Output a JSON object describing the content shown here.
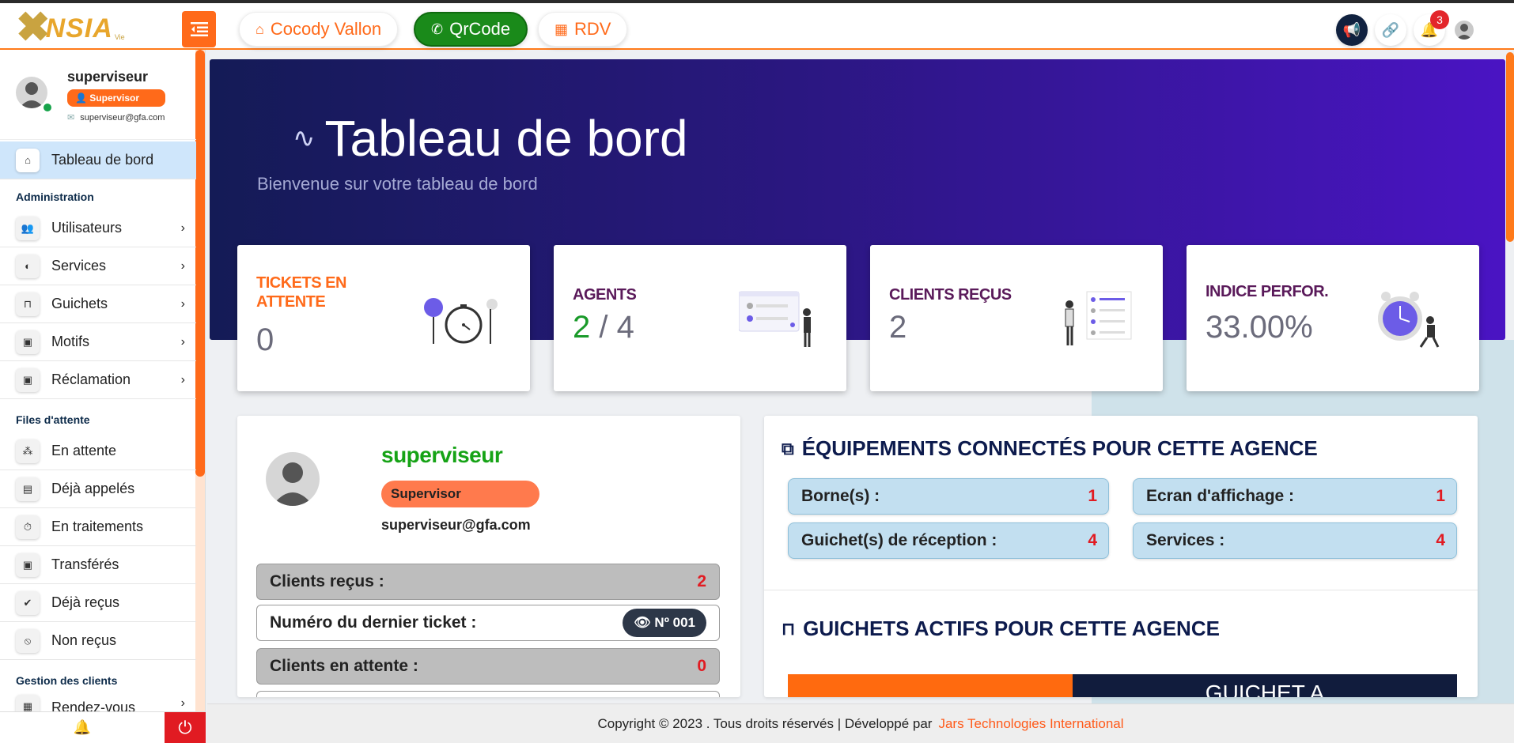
{
  "topbar": {
    "logo": {
      "mark": "✖",
      "text": "NSIA",
      "sub": "Vie"
    },
    "agency_label": "Cocody Vallon",
    "qrcode_label": "QrCode",
    "rdv_label": "RDV",
    "notification_count": "3"
  },
  "profile": {
    "name": "superviseur",
    "role": "Supervisor",
    "email": "superviseur@gfa.com"
  },
  "sidebar": {
    "dashboard": "Tableau de bord",
    "section_admin": "Administration",
    "admin_items": [
      "Utilisateurs",
      "Services",
      "Guichets",
      "Motifs",
      "Réclamation"
    ],
    "section_queues": "Files d'attente",
    "queue_items": [
      "En attente",
      "Déjà appelés",
      "En traitements",
      "Transférés",
      "Déjà reçus",
      "Non reçus"
    ],
    "section_clients": "Gestion des clients",
    "client_items": [
      "Rendez-vous"
    ]
  },
  "hero": {
    "title": "Tableau de bord",
    "subtitle": "Bienvenue sur votre tableau de bord"
  },
  "stats": [
    {
      "label_line1": "TICKETS EN",
      "label_line2": "ATTENTE",
      "value": "0",
      "color": "#ff6a1a"
    },
    {
      "label": "AGENTS",
      "value_active": "2",
      "value_sep": " / ",
      "value_total": "4",
      "color": "#5a1a5a"
    },
    {
      "label": "CLIENTS REÇUS",
      "value": "2",
      "color": "#5a1a5a"
    },
    {
      "label": "INDICE PERFOR.",
      "value": "33.00%",
      "color": "#5a1a5a"
    }
  ],
  "supervisor_card": {
    "name": "superviseur",
    "role": "Supervisor",
    "email": "superviseur@gfa.com",
    "clients_recus_label": "Clients reçus :",
    "clients_recus_value": "2",
    "last_ticket_label": "Numéro du dernier ticket :",
    "last_ticket_value": "Nº 001",
    "clients_attente_label": "Clients en attente :",
    "clients_attente_value": "0"
  },
  "equipment": {
    "title": "ÉQUIPEMENTS CONNECTÉS POUR CETTE AGENCE",
    "items": [
      {
        "label": "Borne(s) :",
        "value": "1"
      },
      {
        "label": "Ecran d'affichage :",
        "value": "1"
      },
      {
        "label": "Guichet(s) de réception :",
        "value": "4"
      },
      {
        "label": "Services :",
        "value": "4"
      }
    ],
    "guichets_title": "GUICHETS ACTIFS POUR CETTE AGENCE",
    "guichet_name": "GUICHET A"
  },
  "footer": {
    "text": "Copyright © 2023 . Tous droits réservés | Développé par",
    "link": "Jars Technologies International"
  }
}
